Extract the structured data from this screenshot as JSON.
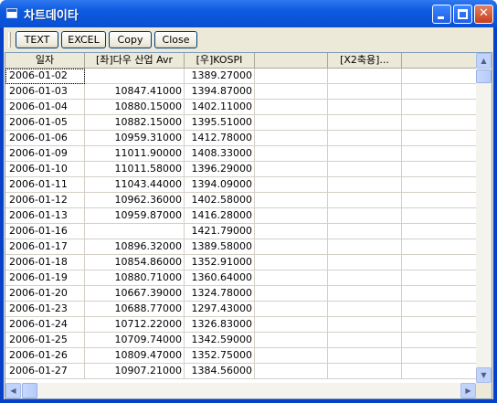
{
  "window": {
    "title": "차트데이타",
    "minimize_glyph": "",
    "maximize_glyph": "",
    "close_glyph": "✕"
  },
  "toolbar": {
    "buttons": [
      "TEXT",
      "EXCEL",
      "Copy",
      "Close"
    ]
  },
  "table": {
    "columns": [
      "일자",
      "[좌]다우 산업 Avr",
      "[우]KOSPI",
      "",
      "[X2축용]..."
    ],
    "rows": [
      [
        "2006-01-02",
        "",
        "1389.27000",
        "",
        ""
      ],
      [
        "2006-01-03",
        "10847.41000",
        "1394.87000",
        "",
        ""
      ],
      [
        "2006-01-04",
        "10880.15000",
        "1402.11000",
        "",
        ""
      ],
      [
        "2006-01-05",
        "10882.15000",
        "1395.51000",
        "",
        ""
      ],
      [
        "2006-01-06",
        "10959.31000",
        "1412.78000",
        "",
        ""
      ],
      [
        "2006-01-09",
        "11011.90000",
        "1408.33000",
        "",
        ""
      ],
      [
        "2006-01-10",
        "11011.58000",
        "1396.29000",
        "",
        ""
      ],
      [
        "2006-01-11",
        "11043.44000",
        "1394.09000",
        "",
        ""
      ],
      [
        "2006-01-12",
        "10962.36000",
        "1402.58000",
        "",
        ""
      ],
      [
        "2006-01-13",
        "10959.87000",
        "1416.28000",
        "",
        ""
      ],
      [
        "2006-01-16",
        "",
        "1421.79000",
        "",
        ""
      ],
      [
        "2006-01-17",
        "10896.32000",
        "1389.58000",
        "",
        ""
      ],
      [
        "2006-01-18",
        "10854.86000",
        "1352.91000",
        "",
        ""
      ],
      [
        "2006-01-19",
        "10880.71000",
        "1360.64000",
        "",
        ""
      ],
      [
        "2006-01-20",
        "10667.39000",
        "1324.78000",
        "",
        ""
      ],
      [
        "2006-01-23",
        "10688.77000",
        "1297.43000",
        "",
        ""
      ],
      [
        "2006-01-24",
        "10712.22000",
        "1326.83000",
        "",
        ""
      ],
      [
        "2006-01-25",
        "10709.74000",
        "1342.59000",
        "",
        ""
      ],
      [
        "2006-01-26",
        "10809.47000",
        "1352.75000",
        "",
        ""
      ],
      [
        "2006-01-27",
        "10907.21000",
        "1384.56000",
        "",
        ""
      ]
    ]
  },
  "scrollbars": {
    "up_arrow": "▲",
    "down_arrow": "▼",
    "left_arrow": "◀",
    "right_arrow": "▶"
  },
  "colors": {
    "titlebar": "#0a4fd2",
    "face": "#ece9d8",
    "grid_line": "#d4d0c8"
  }
}
